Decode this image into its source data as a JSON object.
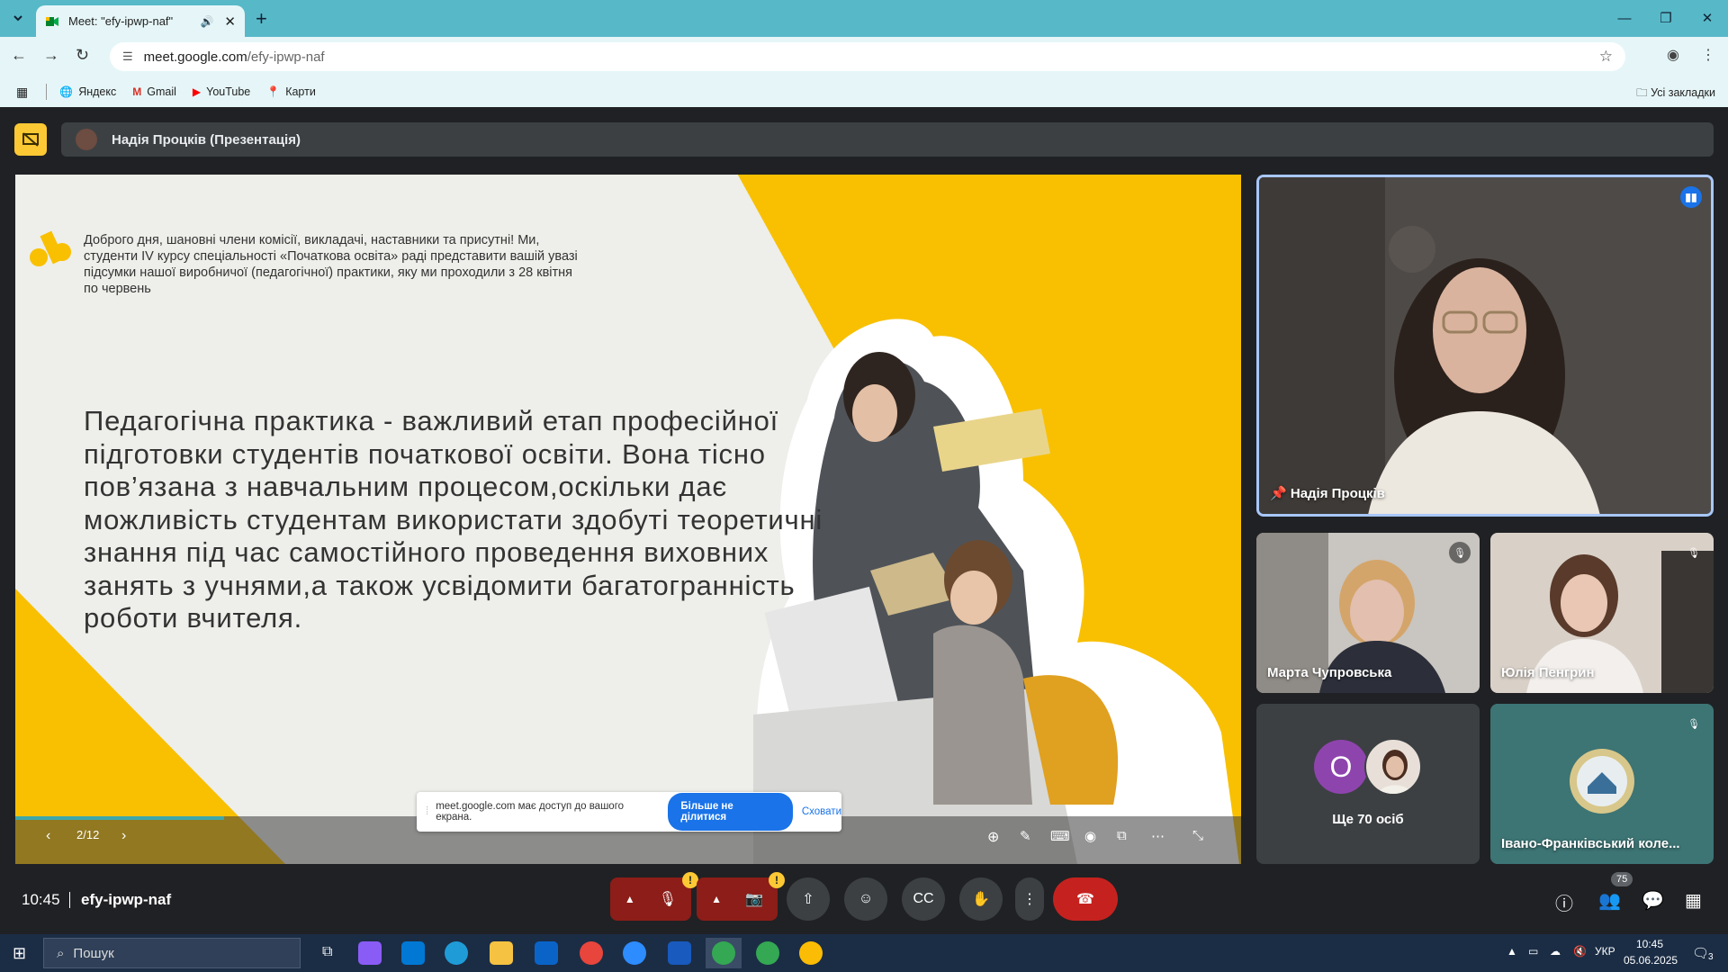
{
  "browser": {
    "tab_title": "Meet: \"efy-ipwp-naf\"",
    "url_host": "meet.google.com",
    "url_path": "/efy-ipwp-naf",
    "bookmarks": [
      {
        "label": "Яндекс"
      },
      {
        "label": "Gmail"
      },
      {
        "label": "YouTube"
      },
      {
        "label": "Карти"
      }
    ],
    "all_bookmarks": "Усі закладки"
  },
  "meet": {
    "presenter_label": "Надія Процків (Презентація)",
    "slide": {
      "intro": "Доброго дня, шановні члени комісії, викладачі, наставники та присутні! Ми, студенти IV курсу спеціальності «Початкова освіта» раді представити вашій увазі підсумки нашої виробничої (педагогічної) практики, яку ми проходили з 28 квітня по червень",
      "body": "Педагогічна практика - важливий етап професійної підготовки студентів початкової освіти. Вона тісно пов’язана з навчальним процесом,оскільки дає можливість студентам використати здобуті теоретичні знання під час самостійного проведення виховних занять з учнями,а також усвідомити багатогранність роботи вчителя.",
      "counter": "2/12",
      "progress": 0.17
    },
    "share_notice": {
      "text": "meet.google.com має доступ до вашого екрана.",
      "stop_label": "Більше не ділитися",
      "hide_label": "Сховати"
    },
    "participants": [
      {
        "name": "Надія Процків"
      },
      {
        "name": "Марта Чупровська"
      },
      {
        "name": "Юлія Пенгрин"
      },
      {
        "name": "Ще 70 осіб",
        "avatar_letter": "О"
      },
      {
        "name": "Івано-Франківський коле..."
      }
    ],
    "time": "10:45",
    "meeting_code": "efy-ipwp-naf",
    "participants_count": "75"
  },
  "taskbar": {
    "search_placeholder": "Пошук",
    "lang": "УКР",
    "time": "10:45",
    "date": "05.06.2025",
    "notifications": "3"
  },
  "colors": {
    "chrome": "#57b8c8",
    "meet_bg": "#202124",
    "slide_yellow": "#f8c000",
    "hangup": "#c5221f"
  }
}
